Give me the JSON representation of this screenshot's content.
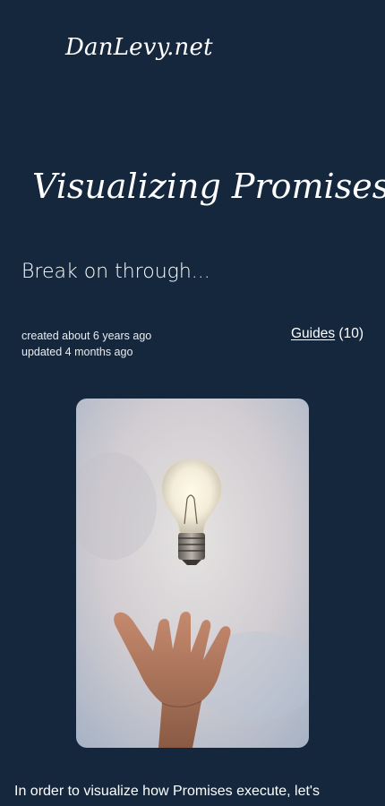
{
  "site": {
    "logo_text": "DanLevy.net"
  },
  "article": {
    "title": "Visualizing Promises",
    "subtitle": "Break on through...",
    "created": "created about 6 years ago",
    "updated": "updated 4 months ago",
    "category_label": "Guides",
    "category_count": "(10)",
    "intro_text": "In order to visualize how Promises execute, let's"
  },
  "hero": {
    "image_label": "lightbulb-above-hand-photo"
  },
  "colors": {
    "background": "#14273d",
    "text": "#ffffff"
  }
}
